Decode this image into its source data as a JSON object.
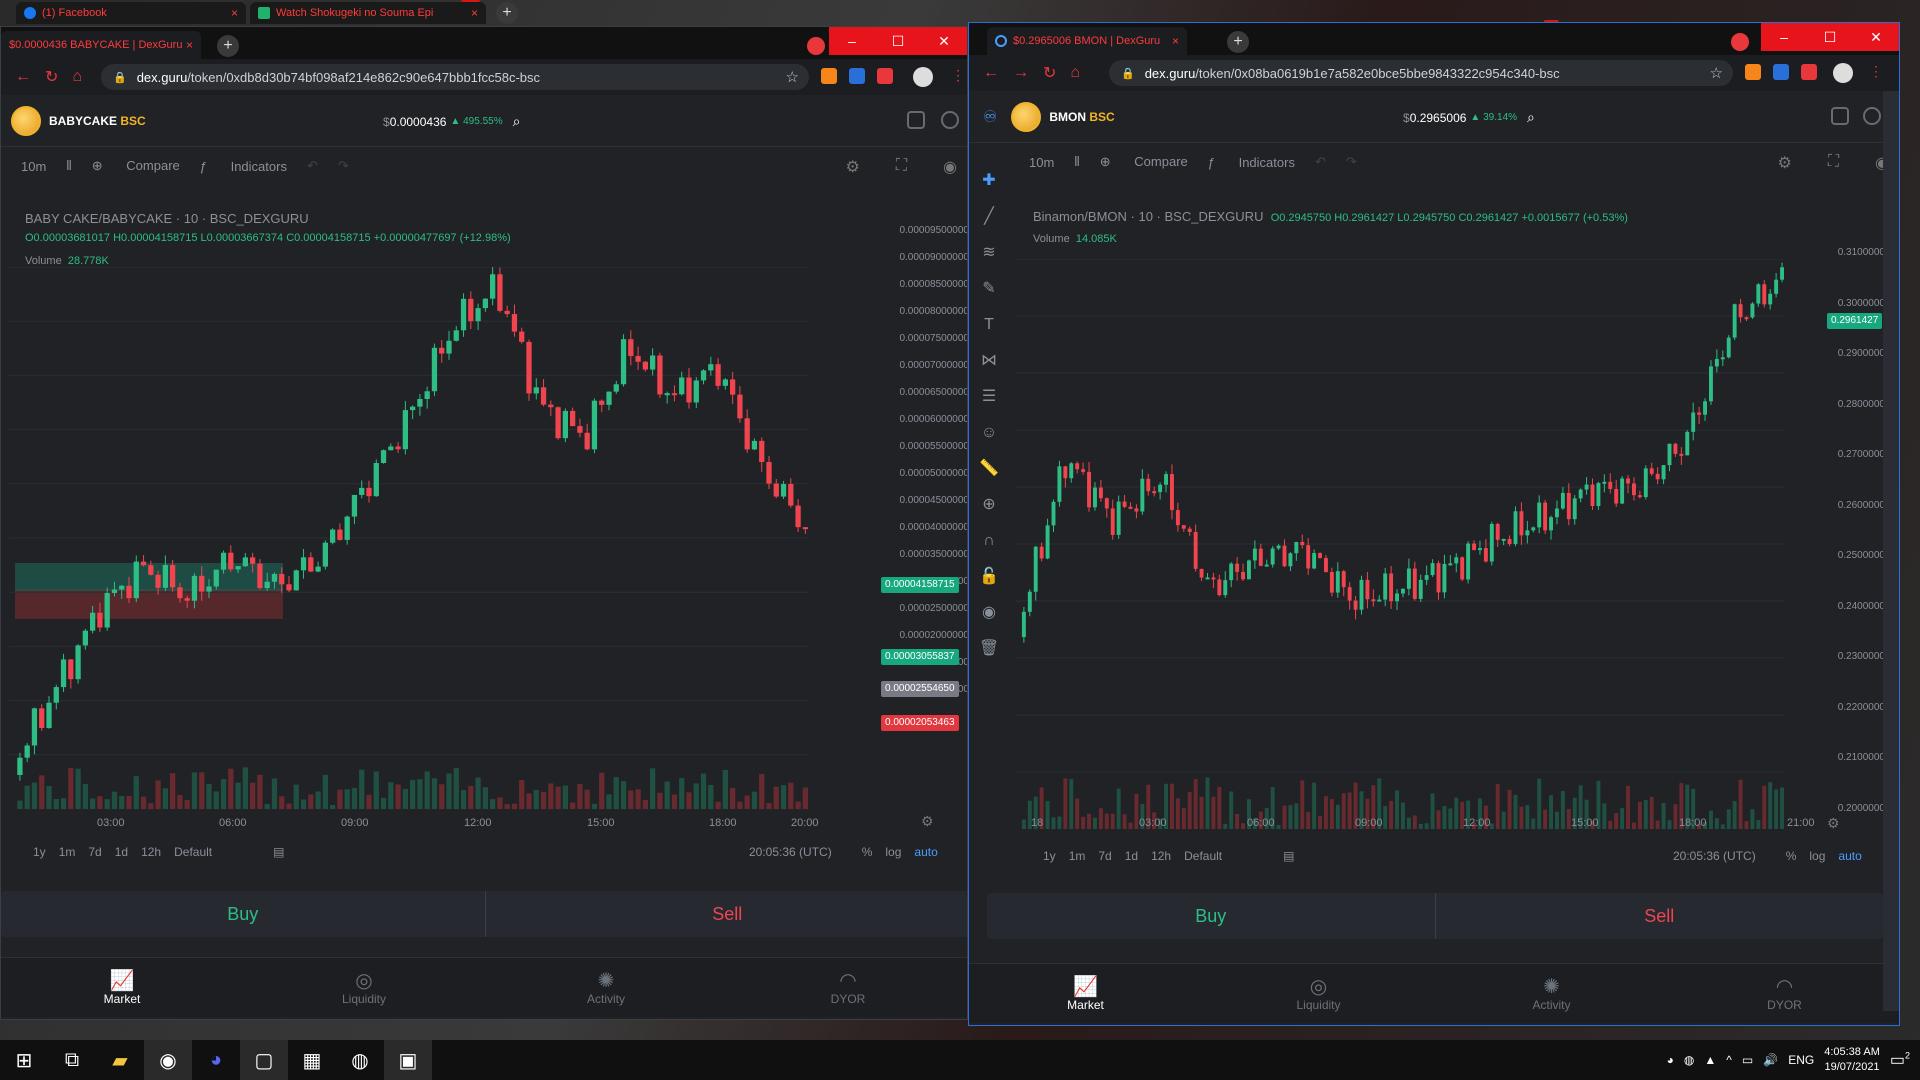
{
  "left_window": {
    "tabs": [
      {
        "title": "$0.0000436 BABYCAKE | DexGuru"
      }
    ],
    "background_tabs": [
      {
        "title": "(1) Facebook"
      },
      {
        "title": "Watch Shokugeki no Souma Epi"
      }
    ],
    "url_host": "dex.guru",
    "url_path": "/token/0xdb8d30b74bf098af214e862c90e647bbb1fcc58c-bsc",
    "symbol": "BABYCAKE",
    "chain": "BSC",
    "price": "0.0000436",
    "price_prefix": "$",
    "change": "495.55%",
    "toolbar": {
      "interval": "10m",
      "compare": "Compare",
      "indicators": "Indicators"
    },
    "legend_title": "BABY CAKE/BABYCAKE · 10 · BSC_DEXGURU",
    "ohlc": "O0.00003681017 H0.00004158715 L0.00003667374 C0.00004158715 +0.00000477697 (+12.98%)",
    "volume_label": "Volume",
    "volume_value": "28.778K",
    "y_ticks": [
      "0.00009500000",
      "0.00009000000",
      "0.00008500000",
      "0.00008000000",
      "0.00007500000",
      "0.00007000000",
      "0.00006500000",
      "0.00006000000",
      "0.00005500000",
      "0.00005000000",
      "0.00004500000",
      "0.00004000000",
      "0.00003500000",
      "0.00003000000",
      "0.00002500000",
      "0.00002000000",
      "0.00001500000",
      "0.00001000000"
    ],
    "tags": {
      "current": "0.00004158715",
      "tp": "0.00003055837",
      "entry": "0.00002554650",
      "sl": "0.00002053463"
    },
    "x_ticks": [
      "03:00",
      "06:00",
      "09:00",
      "12:00",
      "15:00",
      "18:00",
      "20:00"
    ],
    "ranges": [
      "1y",
      "1m",
      "7d",
      "1d",
      "12h",
      "Default"
    ],
    "time": "20:05:36 (UTC)",
    "scale": [
      "%",
      "log",
      "auto"
    ],
    "buy": "Buy",
    "sell": "Sell",
    "nav": [
      "Market",
      "Liquidity",
      "Activity",
      "DYOR"
    ]
  },
  "right_window": {
    "tabs": [
      {
        "title": "$0.2965006 BMON | DexGuru"
      }
    ],
    "url_host": "dex.guru",
    "url_path": "/token/0x08ba0619b1e7a582e0bce5bbe9843322c954c340-bsc",
    "symbol": "BMON",
    "chain": "BSC",
    "price": "0.2965006",
    "price_prefix": "$",
    "change": "39.14%",
    "toolbar": {
      "interval": "10m",
      "compare": "Compare",
      "indicators": "Indicators"
    },
    "legend_title": "Binamon/BMON · 10 · BSC_DEXGURU",
    "ohlc": "O0.2945750 H0.2961427 L0.2945750 C0.2961427 +0.0015677 (+0.53%)",
    "volume_label": "Volume",
    "volume_value": "14.085K",
    "y_ticks": [
      "0.3100000",
      "0.3000000",
      "0.2900000",
      "0.2800000",
      "0.2700000",
      "0.2600000",
      "0.2500000",
      "0.2400000",
      "0.2300000",
      "0.2200000",
      "0.2100000",
      "0.2000000"
    ],
    "tags": {
      "current": "0.2961427"
    },
    "x_ticks": [
      "18",
      "03:00",
      "06:00",
      "09:00",
      "12:00",
      "15:00",
      "18:00",
      "21:00"
    ],
    "ranges": [
      "1y",
      "1m",
      "7d",
      "1d",
      "12h",
      "Default"
    ],
    "time": "20:05:36 (UTC)",
    "scale": [
      "%",
      "log",
      "auto"
    ],
    "buy": "Buy",
    "sell": "Sell",
    "nav": [
      "Market",
      "Liquidity",
      "Activity",
      "DYOR"
    ]
  },
  "taskbar": {
    "lang": "ENG",
    "time": "4:05:38 AM",
    "date": "19/07/2021",
    "notif_count": "2"
  },
  "colors": {
    "up": "#2ebd85",
    "down": "#f0454e",
    "bg": "#202226",
    "accent_red": "#e8141b"
  }
}
